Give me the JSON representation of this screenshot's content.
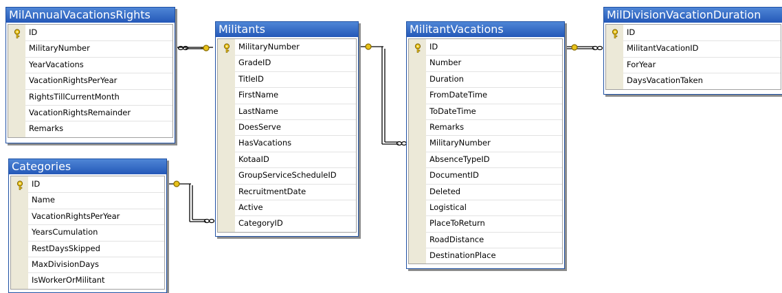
{
  "tables": [
    {
      "id": "mil-annual",
      "title": "MilAnnualVacationsRights",
      "columns": [
        {
          "name": "ID",
          "pk": true
        },
        {
          "name": "MilitaryNumber"
        },
        {
          "name": "YearVacations"
        },
        {
          "name": "VacationRightsPerYear"
        },
        {
          "name": "RightsTillCurrentMonth"
        },
        {
          "name": "VacationRightsRemainder"
        },
        {
          "name": "Remarks"
        }
      ]
    },
    {
      "id": "categories",
      "title": "Categories",
      "columns": [
        {
          "name": "ID",
          "pk": true
        },
        {
          "name": "Name"
        },
        {
          "name": "VacationRightsPerYear"
        },
        {
          "name": "YearsCumulation"
        },
        {
          "name": "RestDaysSkipped"
        },
        {
          "name": "MaxDivisionDays"
        },
        {
          "name": "IsWorkerOrMilitant"
        }
      ]
    },
    {
      "id": "militants",
      "title": "Militants",
      "columns": [
        {
          "name": "MilitaryNumber",
          "pk": true
        },
        {
          "name": "GradeID"
        },
        {
          "name": "TitleID"
        },
        {
          "name": "FirstName"
        },
        {
          "name": "LastName"
        },
        {
          "name": "DoesServe"
        },
        {
          "name": "HasVacations"
        },
        {
          "name": "KotaaID"
        },
        {
          "name": "GroupServiceScheduleID"
        },
        {
          "name": "RecruitmentDate"
        },
        {
          "name": "Active"
        },
        {
          "name": "CategoryID"
        }
      ]
    },
    {
      "id": "militant-vacations",
      "title": "MilitantVacations",
      "columns": [
        {
          "name": "ID",
          "pk": true
        },
        {
          "name": "Number"
        },
        {
          "name": "Duration"
        },
        {
          "name": "FromDateTime"
        },
        {
          "name": "ToDateTime"
        },
        {
          "name": "Remarks"
        },
        {
          "name": "MilitaryNumber"
        },
        {
          "name": "AbsenceTypeID"
        },
        {
          "name": "DocumentID"
        },
        {
          "name": "Deleted"
        },
        {
          "name": "Logistical"
        },
        {
          "name": "PlaceToReturn"
        },
        {
          "name": "RoadDistance"
        },
        {
          "name": "DestinationPlace"
        }
      ]
    },
    {
      "id": "mil-division",
      "title": "MilDivisionVacationDuration",
      "columns": [
        {
          "name": "ID",
          "pk": true
        },
        {
          "name": "MilitantVacationID"
        },
        {
          "name": "ForYear"
        },
        {
          "name": "DaysVacationTaken"
        }
      ]
    }
  ],
  "relationships": [
    {
      "from": "militants",
      "to": "mil-annual",
      "line_color": "#000000",
      "key_color": "#e8c21a"
    },
    {
      "from": "categories",
      "to": "militants",
      "line_color": "#000000",
      "key_color": "#e8c21a"
    },
    {
      "from": "militants",
      "to": "militant-vacations",
      "line_color": "#000000",
      "key_color": "#e8c21a"
    },
    {
      "from": "militant-vacations",
      "to": "mil-division",
      "line_color": "#000000",
      "key_color": "#e8c21a"
    }
  ],
  "colors": {
    "title_bar": "#2f64c0",
    "border": "#1d4fa3",
    "selector_column": "#ece9d8",
    "key_icon": "#e8c21a"
  }
}
